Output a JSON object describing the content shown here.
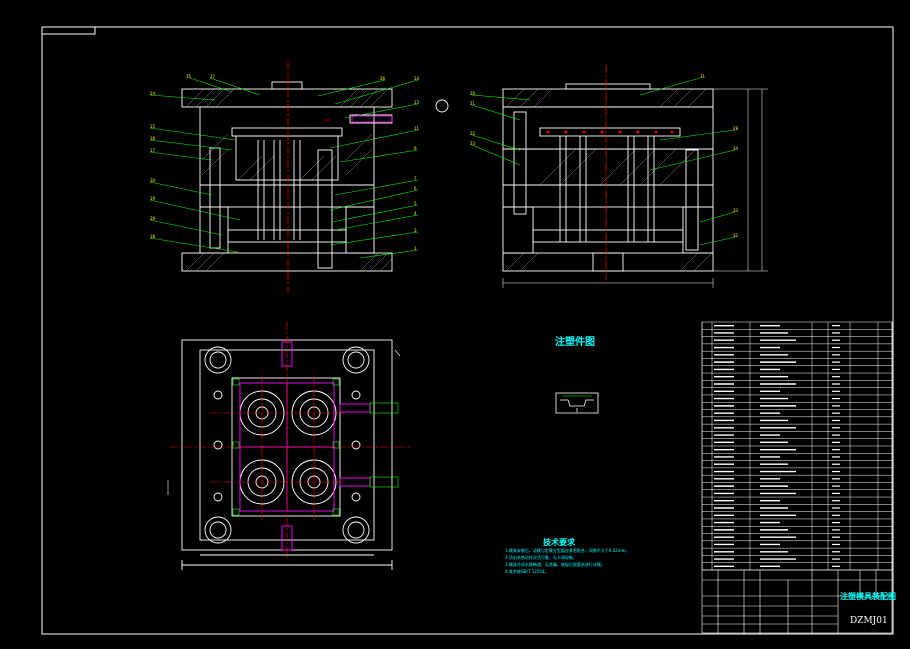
{
  "drawing": {
    "part_drawing_title": "注塑件图",
    "tech_requirements_title": "技术要求",
    "tech_requirements_lines": [
      "1.模具安装后，动模与定模分型面应紧密贴合，间隙不大于0.02mm。",
      "2.顶出系统动作灵活可靠，无卡滞现象。",
      "3.模具冷却水路畅通，无渗漏，装配后按要求进行试模。",
      "4.其余按GB/T 12554。"
    ],
    "title_block": {
      "name": "注塑模具装配图",
      "drawing_code": "DZMJ01"
    }
  },
  "bom": {
    "rows": 34
  },
  "colors": {
    "background": "#000000",
    "outline": "#ffffff",
    "leader": "#00ff00",
    "center": "#ff0000",
    "label": "#ffff00",
    "cavity": "#ff00ff",
    "text": "#00ffff"
  }
}
